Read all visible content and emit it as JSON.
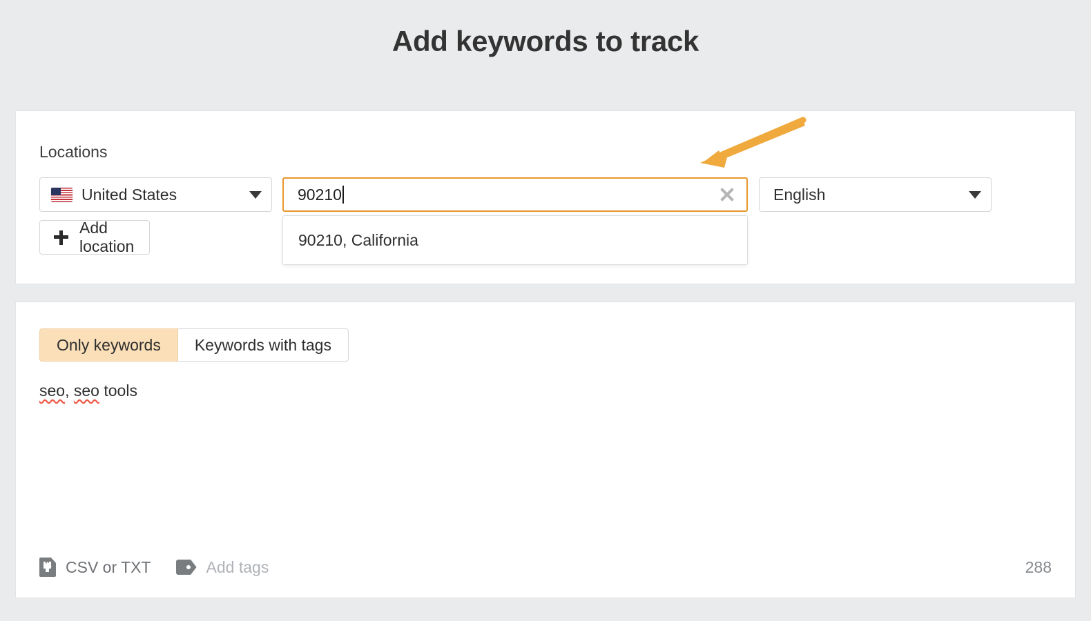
{
  "page": {
    "title": "Add keywords to track",
    "background_color": "#EAEBEC"
  },
  "locations_panel": {
    "label": "Locations",
    "country_select": {
      "value": "United States",
      "flag": "us-flag-icon",
      "chevron": "chevron-down-icon"
    },
    "add_location_button": {
      "label": "Add location",
      "icon": "plus-icon"
    },
    "location_search": {
      "value": "90210",
      "placeholder": "Enter a location",
      "clear_icon": "close-icon",
      "focus_color": "#E8962C",
      "suggestions": [
        {
          "label": "90210, California"
        }
      ]
    },
    "language_select": {
      "value": "English",
      "chevron": "chevron-down-icon"
    },
    "annotation": {
      "type": "arrow",
      "color": "#EFA93C",
      "points_to": "location-search-input"
    }
  },
  "keywords_panel": {
    "tabs": [
      {
        "label": "Only keywords",
        "active": true
      },
      {
        "label": "Keywords with tags",
        "active": false
      }
    ],
    "active_tab_color": "#FADFB8",
    "keywords_text": {
      "segments": [
        {
          "text": "seo",
          "misspelled": true
        },
        {
          "text": ", ",
          "misspelled": false
        },
        {
          "text": "seo",
          "misspelled": true
        },
        {
          "text": " tools",
          "misspelled": false
        }
      ],
      "full_value": "seo, seo tools",
      "placeholder": "Enter keywords"
    },
    "footer": {
      "upload_label": "CSV or TXT",
      "upload_icon": "file-upload-icon",
      "tags_label": "Add tags",
      "tags_icon": "tag-icon",
      "counter": "288"
    }
  }
}
